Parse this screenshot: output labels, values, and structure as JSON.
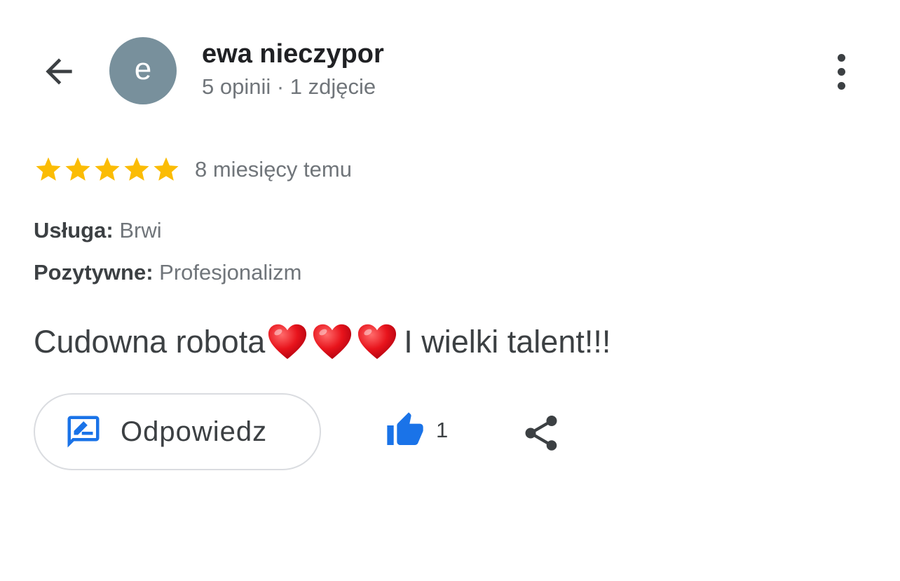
{
  "header": {
    "avatar_letter": "e",
    "avatar_color": "#78909c",
    "user_name": "ewa nieczypor",
    "user_meta": "5 opinii · 1 zdjęcie",
    "back_icon": "arrow-back-icon",
    "more_icon": "more-vert-icon"
  },
  "review": {
    "rating": 5,
    "max_rating": 5,
    "star_color": "#fbbc04",
    "time_ago": "8 miesięcy temu",
    "service_label": "Usługa:",
    "service_value": "Brwi",
    "positive_label": "Pozytywne:",
    "positive_value": "Profesjonalizm",
    "text_before": "Cudowna robota",
    "emoji": [
      "❤️",
      "❤️",
      "❤️"
    ],
    "text_after": "I wielki talent!!!"
  },
  "actions": {
    "reply_label": "Odpowiedz",
    "reply_icon": "rate-review-icon",
    "like_icon": "thumb-up-icon",
    "like_count": "1",
    "share_icon": "share-icon",
    "accent_color": "#1a73e8"
  }
}
